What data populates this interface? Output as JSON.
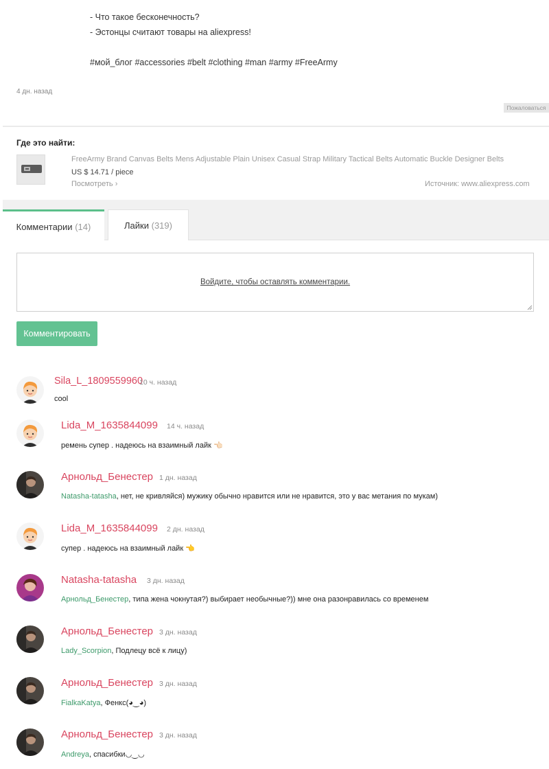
{
  "post": {
    "lines": [
      "- Что такое бесконечность?",
      "- Эстонцы считают товары на aliexpress!"
    ],
    "hashtags": "#мой_блог #accessories #belt #clothing #man #army #FreeArmy",
    "time": "4 дн. назад",
    "report_label": "Пожаловаться"
  },
  "where": {
    "title": "Где это найти:",
    "product_name": "FreeArmy Brand Canvas Belts Mens Adjustable Plain Unisex Casual Strap Military Tactical Belts Automatic Buckle Designer Belts",
    "price": "US $ 14.71 / piece",
    "view_link": "Посмотреть ›",
    "source": "Источник: www.aliexpress.com"
  },
  "tabs": [
    {
      "label": "Комментарии",
      "count": "(14)"
    },
    {
      "label": "Лайки",
      "count": "(319)"
    }
  ],
  "comment_form": {
    "login_prompt": "Войдите, чтобы оставлять комментарии.",
    "submit_label": "Комментировать"
  },
  "comments": [
    {
      "author": "Sila_L_1809559960",
      "time": "10 ч. назад",
      "mention": "",
      "text": "cool",
      "avatar": "kid"
    },
    {
      "author": "Lida_M_1635844099",
      "time": "14 ч. назад",
      "mention": "",
      "text": "ремень супер . надеюсь на взаимный лайк 👈🏻",
      "avatar": "kid"
    },
    {
      "author": "Арнольд_Бенестер",
      "time": "1 дн. назад",
      "mention": "Natasha-tatasha",
      "text": ", нет, не кривляйся) мужику обычно нравится или не нравится, это у вас метания по мукам)",
      "avatar": "dark"
    },
    {
      "author": "Lida_M_1635844099",
      "time": "2 дн. назад",
      "mention": "",
      "text": "супер . надеюсь на взаимный лайк 👈",
      "avatar": "kid"
    },
    {
      "author": "Natasha-tatasha",
      "time": "3 дн. назад",
      "mention": "Арнольд_Бенестер",
      "text": ", типа жена чокнутая?) выбирает необычные?)) мне она разонравилась со временем",
      "avatar": "pink"
    },
    {
      "author": "Арнольд_Бенестер",
      "time": "3 дн. назад",
      "mention": "Lady_Scorpion",
      "text": ", Подлецу всё к лицу)",
      "avatar": "dark"
    },
    {
      "author": "Арнольд_Бенестер",
      "time": "3 дн. назад",
      "mention": "FialkaKatya",
      "text": ", Фенкс(◕‿◕)",
      "avatar": "dark"
    },
    {
      "author": "Арнольд_Бенестер",
      "time": "3 дн. назад",
      "mention": "Andreya",
      "text": ", спасибки◡‿◡",
      "avatar": "dark"
    }
  ]
}
